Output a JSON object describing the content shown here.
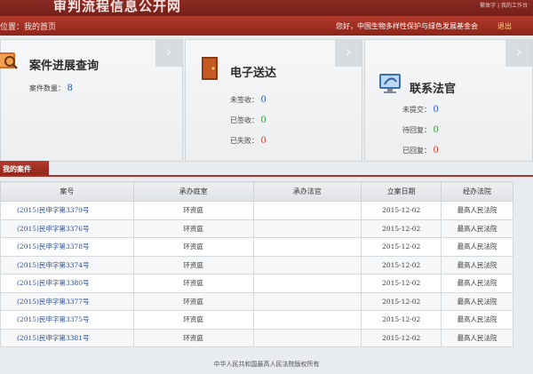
{
  "header": {
    "site_title": "审判流程信息公开网",
    "top_links": "繁体字 | 我的工作台",
    "location_label": "位置：",
    "location_value": "我的首页",
    "greeting": "您好，中国生物多样性保护与绿色发展基金会",
    "logout": "退出"
  },
  "panels": {
    "progress": {
      "title": "案件进展查询",
      "count_label": "案件数量：",
      "count_value": "8"
    },
    "delivery": {
      "title": "电子送达",
      "items": [
        {
          "label": "未签收：",
          "value": "0"
        },
        {
          "label": "已签收：",
          "value": "0"
        },
        {
          "label": "已失败：",
          "value": "0"
        }
      ]
    },
    "contact": {
      "title": "联系法官",
      "items": [
        {
          "label": "未提交：",
          "value": "0"
        },
        {
          "label": "待回复：",
          "value": "0"
        },
        {
          "label": "已回复：",
          "value": "0"
        }
      ]
    }
  },
  "cases": {
    "tab_label": "我的案件",
    "columns": [
      "案号",
      "承办庭室",
      "承办法官",
      "立案日期",
      "经办法院"
    ],
    "rows": [
      [
        "(2015)民申字第3379号",
        "环资庭",
        "",
        "2015-12-02",
        "最高人民法院"
      ],
      [
        "(2015)民申字第3376号",
        "环资庭",
        "",
        "2015-12-02",
        "最高人民法院"
      ],
      [
        "(2015)民申字第3378号",
        "环资庭",
        "",
        "2015-12-02",
        "最高人民法院"
      ],
      [
        "(2015)民申字第3374号",
        "环资庭",
        "",
        "2015-12-02",
        "最高人民法院"
      ],
      [
        "(2015)民申字第3380号",
        "环资庭",
        "",
        "2015-12-02",
        "最高人民法院"
      ],
      [
        "(2015)民申字第3377号",
        "环资庭",
        "",
        "2015-12-02",
        "最高人民法院"
      ],
      [
        "(2015)民申字第3375号",
        "环资庭",
        "",
        "2015-12-02",
        "最高人民法院"
      ],
      [
        "(2015)民申字第3381号",
        "环资庭",
        "",
        "2015-12-02",
        "最高人民法院"
      ]
    ]
  },
  "footer": {
    "copyright": "中华人民共和国最高人民法院版权所有"
  },
  "colors": {
    "brand_red": "#a83226",
    "link_blue": "#2a4f9a",
    "value_blue": "#2456b8",
    "value_green": "#2a9a35",
    "value_red": "#d23a2a"
  },
  "icons": {
    "progress": "magnifier-folder-icon",
    "delivery": "door-icon",
    "contact": "monitor-icon",
    "panel_arrow": "arrow-right-icon"
  }
}
